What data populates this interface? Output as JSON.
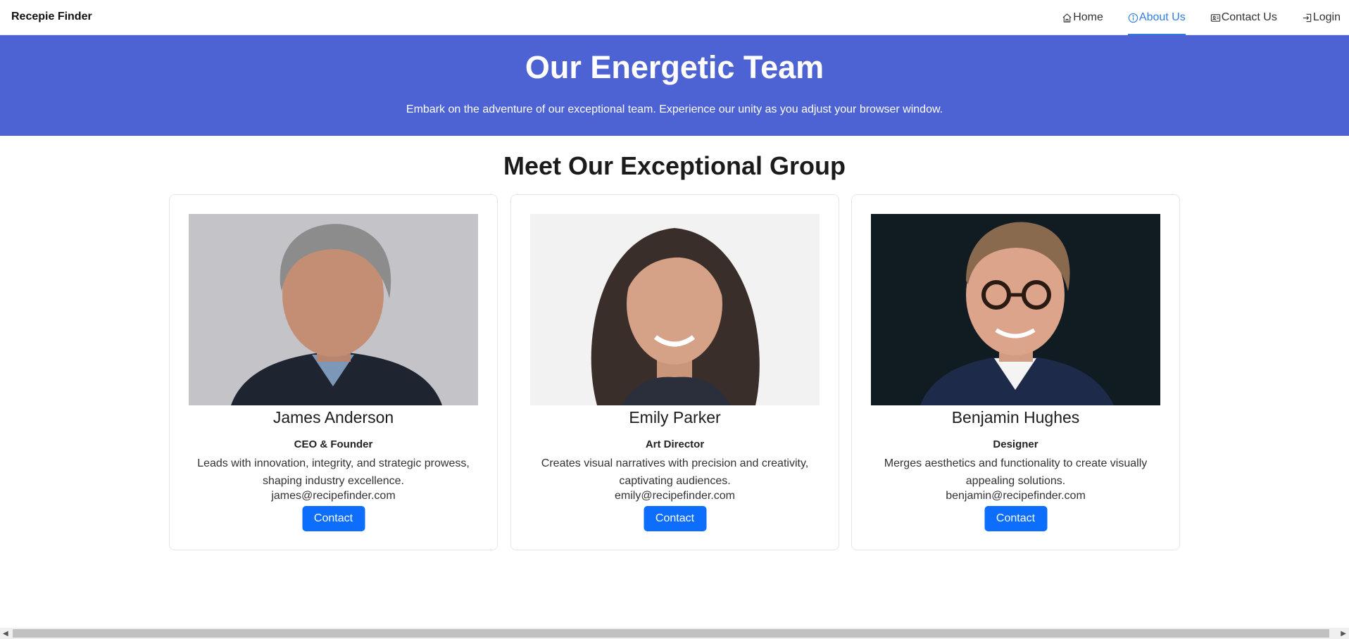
{
  "brand": "Recepie Finder",
  "nav": [
    {
      "label": "Home",
      "icon": "home-icon",
      "active": false
    },
    {
      "label": "About Us",
      "icon": "info-icon",
      "active": true
    },
    {
      "label": "Contact Us",
      "icon": "contact-card-icon",
      "active": false
    },
    {
      "label": "Login",
      "icon": "login-icon",
      "active": false
    }
  ],
  "hero": {
    "title": "Our Energetic Team",
    "subtitle": "Embark on the adventure of our exceptional team. Experience our unity as you adjust your browser window."
  },
  "section_title": "Meet Our Exceptional Group",
  "team": [
    {
      "name": "James Anderson",
      "role": "CEO & Founder",
      "description": "Leads with innovation, integrity, and strategic prowess, shaping industry excellence.",
      "email": "james@recipefinder.com",
      "button": "Contact"
    },
    {
      "name": "Emily Parker",
      "role": "Art Director",
      "description": "Creates visual narratives with precision and creativity, captivating audiences.",
      "email": "emily@recipefinder.com",
      "button": "Contact"
    },
    {
      "name": "Benjamin Hughes",
      "role": "Designer",
      "description": "Merges aesthetics and functionality to create visually appealing solutions.",
      "email": "benjamin@recipefinder.com",
      "button": "Contact"
    }
  ],
  "colors": {
    "hero_bg": "#4e63d3",
    "accent": "#2f7de1",
    "button": "#0d6efd"
  }
}
